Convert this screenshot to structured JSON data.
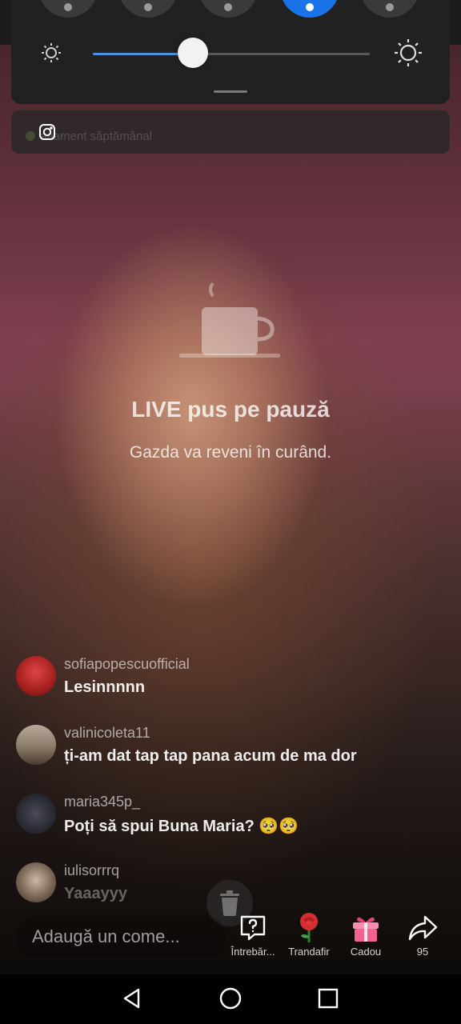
{
  "quick_settings": {
    "brightness_level": 0.36,
    "active_tile_index": 3
  },
  "notification": {
    "text": "aaament săptămânal"
  },
  "live": {
    "title": "LIVE pus pe pauză",
    "subtitle": "Gazda va reveni în curând."
  },
  "comments": [
    {
      "user": "sofiapopescuofficial",
      "text": "Lesinnnnn"
    },
    {
      "user": "valinicoleta11",
      "text": "ți-am dat tap tap pana acum de ma dor"
    },
    {
      "user": "maria345p_",
      "text": "Poți să spui Buna Maria? 🥺🥺"
    },
    {
      "user": "iulisorrrq",
      "text": "Yaaayyy"
    }
  ],
  "bottom_bar": {
    "comment_placeholder": "Adaugă un come...",
    "actions": [
      {
        "label": "Întrebăr...",
        "icon": "question-icon"
      },
      {
        "label": "Trandafir",
        "icon": "rose-icon"
      },
      {
        "label": "Cadou",
        "icon": "gift-icon"
      },
      {
        "label": "95",
        "icon": "share-icon"
      }
    ]
  },
  "colors": {
    "accent": "#1a73e8",
    "panel": "#212121"
  }
}
